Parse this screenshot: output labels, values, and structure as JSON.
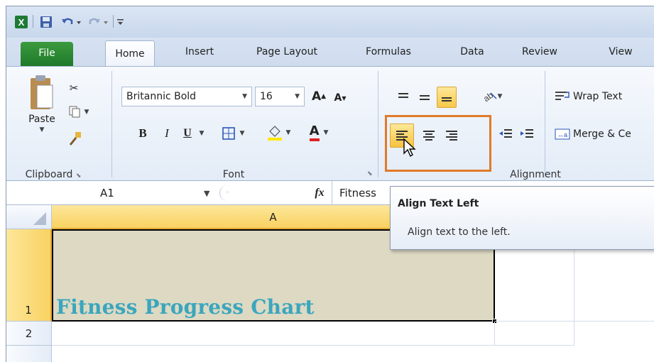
{
  "tabs": [
    "File",
    "Home",
    "Insert",
    "Page Layout",
    "Formulas",
    "Data",
    "Review",
    "View"
  ],
  "clipboard": {
    "paste_label": "Paste",
    "group_label": "Clipboard"
  },
  "font": {
    "family": "Britannic Bold",
    "size": "16",
    "bold": "B",
    "italic": "I",
    "underline": "U",
    "group_label": "Font"
  },
  "alignment": {
    "wrap_label": "Wrap Text",
    "merge_label": "Merge & Ce",
    "group_label": "Alignment"
  },
  "formula_bar": {
    "name_box": "A1",
    "fx": "fx",
    "content": "Fitness"
  },
  "grid": {
    "column_a": "A",
    "row_1": "1",
    "row_2": "2",
    "cell_a1": "Fitness Progress Chart"
  },
  "tooltip": {
    "title": "Align Text Left",
    "body": "Align text to the left."
  },
  "colors": {
    "file_tab": "#2a8a33",
    "highlight_box": "#e07a2a",
    "cell_text": "#3aa6bd",
    "cell_fill": "#ddd9c3",
    "header_selected": "#f9d768"
  }
}
